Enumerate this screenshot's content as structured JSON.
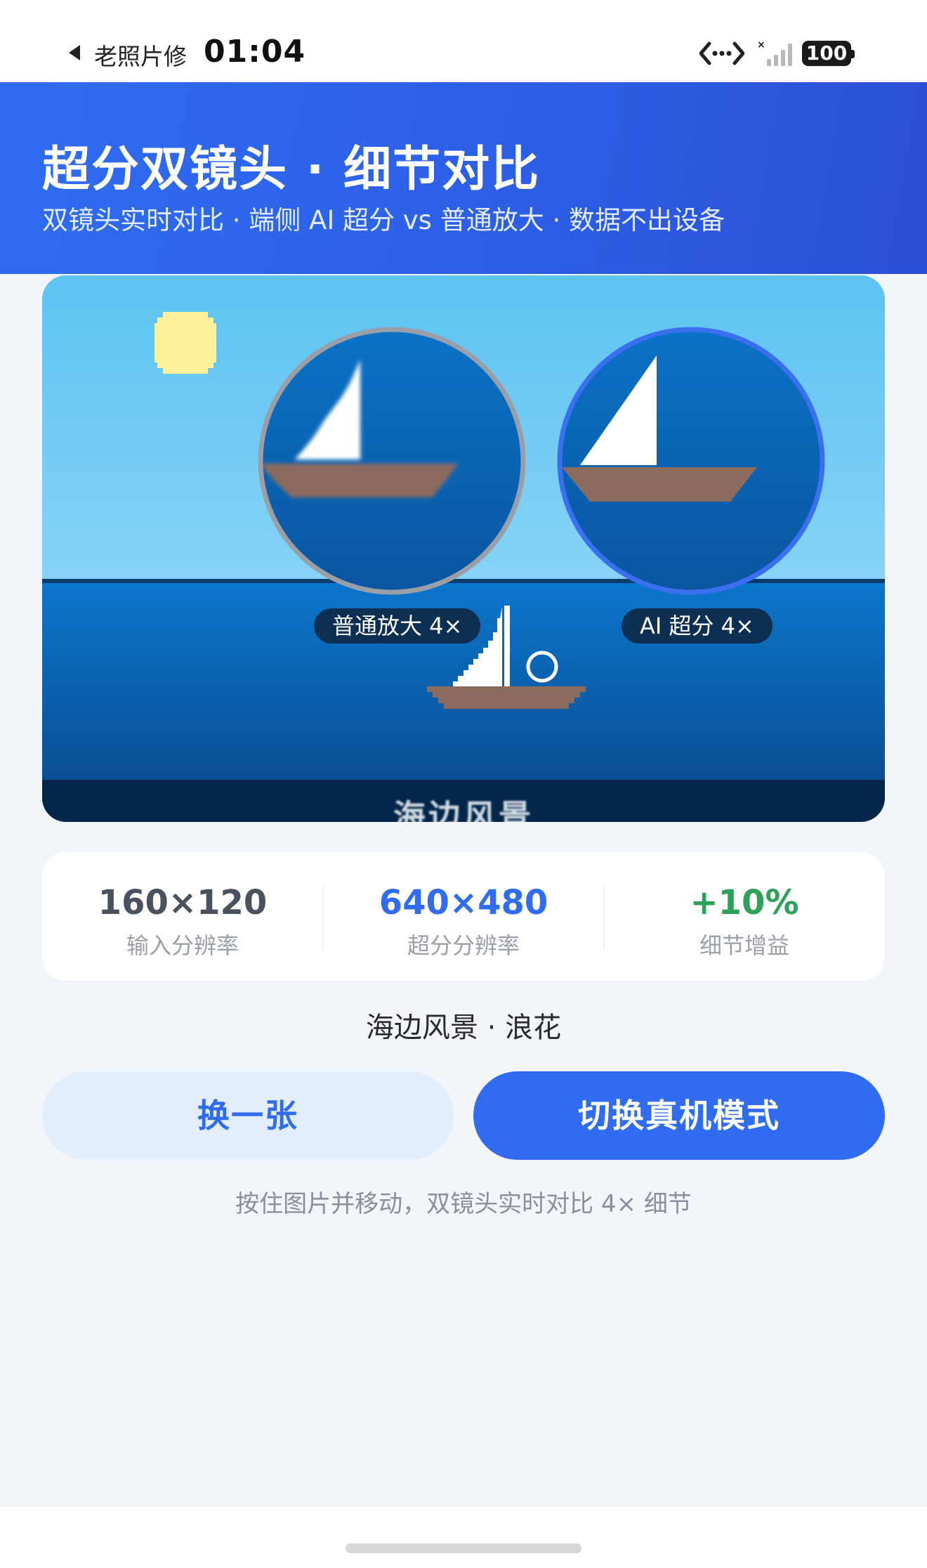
{
  "status_bar": {
    "back_app": "老照片修",
    "time": "01:04",
    "battery": "100"
  },
  "header": {
    "title": "超分双镜头 · 细节对比",
    "subtitle": "双镜头实时对比 · 端侧 AI 超分 vs 普通放大 · 数据不出设备"
  },
  "preview": {
    "lens_normal_label": "普通放大 4×",
    "lens_ai_label": "AI 超分 4×",
    "caption": "海边风景",
    "colors": {
      "sky_top": "#5cc3f2",
      "sky_bottom": "#7fd0f5",
      "sea_top": "#0b73c8",
      "sea_bottom": "#0a4f96",
      "sail": "#ffffff",
      "hull": "#8c6b5f",
      "sun": "#fff29a",
      "ai_ring": "#3a6ff0",
      "normal_ring": "#9a9ea6"
    }
  },
  "stats": [
    {
      "value": "160×120",
      "label": "输入分辨率",
      "color": "#4a5260"
    },
    {
      "value": "640×480",
      "label": "超分分辨率",
      "color": "#2f6cf2"
    },
    {
      "value": "+10%",
      "label": "细节增益",
      "color": "#2ea15a"
    }
  ],
  "scene_title": "海边风景 · 浪花",
  "buttons": {
    "next": "换一张",
    "switch_mode": "切换真机模式"
  },
  "hint": "按住图片并移动，双镜头实时对比 4× 细节"
}
